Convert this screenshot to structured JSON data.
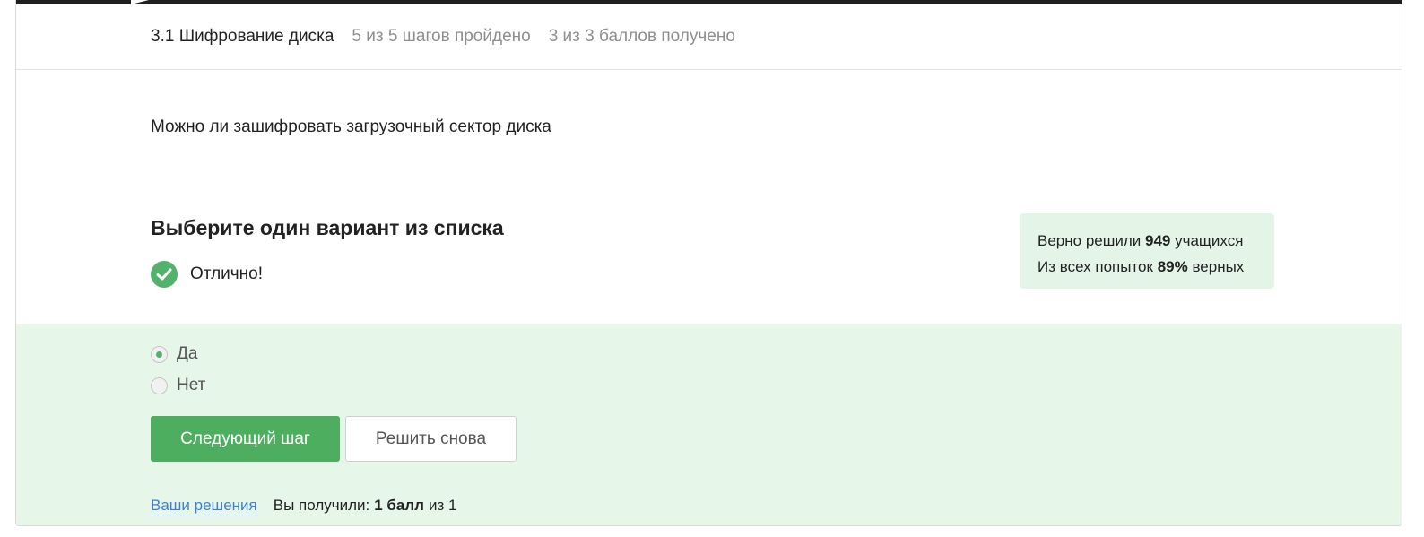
{
  "header": {
    "lesson_title": "3.1 Шифрование диска",
    "steps_progress": "5 из 5 шагов пройдено",
    "score_progress": "3 из 3 баллов  получено"
  },
  "step": {
    "question": "Можно ли зашифровать загрузочный сектор диска",
    "instruction": "Выберите один вариант из списка",
    "result_text": "Отлично!"
  },
  "stats": {
    "line1_prefix": "Верно решили",
    "solved_count": "949",
    "line1_suffix": "учащихся",
    "line2_prefix": "Из всех попыток",
    "correct_percent": "89%",
    "line2_suffix": "верных"
  },
  "options": [
    {
      "label": "Да",
      "checked": true
    },
    {
      "label": "Нет",
      "checked": false
    }
  ],
  "buttons": {
    "next": "Следующий шаг",
    "retry": "Решить снова"
  },
  "footer": {
    "solutions_link": "Ваши решения",
    "received_prefix": "Вы получили:",
    "received_points": "1 балл",
    "received_suffix": "из 1"
  },
  "colors": {
    "accent_green": "#4cae5e",
    "answer_bg": "#e6f6e9",
    "stats_bg": "#e4f5e8",
    "link_blue": "#3b7fd6"
  },
  "icons": {
    "result": "check-circle-icon"
  }
}
